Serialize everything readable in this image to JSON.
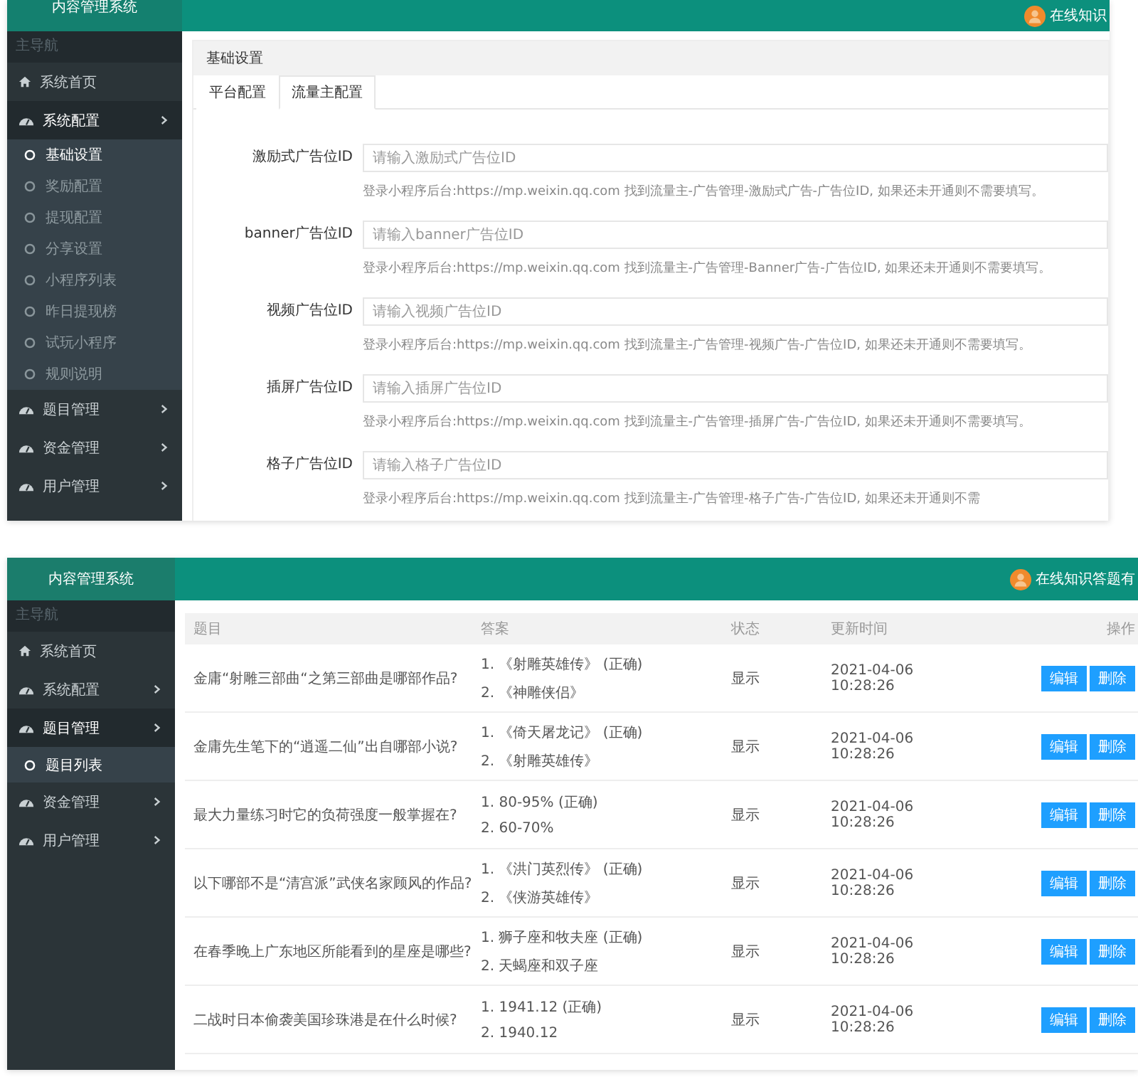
{
  "screens": [
    {
      "kind": "settings",
      "header": {
        "title": "内容管理系统",
        "user": "在线知识"
      },
      "sidebar": {
        "heading": "主导航",
        "items": [
          {
            "label": "系统首页",
            "kind": "link",
            "expanded": false
          },
          {
            "label": "系统配置",
            "kind": "menu",
            "expanded": true,
            "children": [
              {
                "label": "基础设置",
                "selected": true
              },
              {
                "label": "奖励配置",
                "selected": false
              },
              {
                "label": "提现配置",
                "selected": false
              },
              {
                "label": "分享设置",
                "selected": false
              },
              {
                "label": "小程序列表",
                "selected": false
              },
              {
                "label": "昨日提现榜",
                "selected": false
              },
              {
                "label": "试玩小程序",
                "selected": false
              },
              {
                "label": "规则说明",
                "selected": false
              }
            ]
          },
          {
            "label": "题目管理",
            "kind": "menu",
            "expanded": false
          },
          {
            "label": "资金管理",
            "kind": "menu",
            "expanded": false
          },
          {
            "label": "用户管理",
            "kind": "menu",
            "expanded": false
          }
        ]
      },
      "card": {
        "title": "基础设置",
        "tabs": [
          {
            "label": "平台配置",
            "selected": false
          },
          {
            "label": "流量主配置",
            "selected": true
          }
        ],
        "fields": [
          {
            "label": "激励式广告位ID",
            "placeholder": "请输入激励式广告位ID",
            "hint": "登录小程序后台:https://mp.weixin.qq.com 找到流量主-广告管理-激励式广告-广告位ID, 如果还未开通则不需要填写。"
          },
          {
            "label": "banner广告位ID",
            "placeholder": "请输入banner广告位ID",
            "hint": "登录小程序后台:https://mp.weixin.qq.com 找到流量主-广告管理-Banner广告-广告位ID, 如果还未开通则不需要填写。"
          },
          {
            "label": "视频广告位ID",
            "placeholder": "请输入视频广告位ID",
            "hint": "登录小程序后台:https://mp.weixin.qq.com 找到流量主-广告管理-视频广告-广告位ID, 如果还未开通则不需要填写。"
          },
          {
            "label": "插屏广告位ID",
            "placeholder": "请输入插屏广告位ID",
            "hint": "登录小程序后台:https://mp.weixin.qq.com 找到流量主-广告管理-插屏广告-广告位ID, 如果还未开通则不需要填写。"
          },
          {
            "label": "格子广告位ID",
            "placeholder": "请输入格子广告位ID",
            "hint": "登录小程序后台:https://mp.weixin.qq.com 找到流量主-广告管理-格子广告-广告位ID, 如果还未开通则不需"
          }
        ]
      }
    },
    {
      "kind": "table",
      "header": {
        "title": "内容管理系统",
        "user": "在线知识答题有"
      },
      "sidebar": {
        "heading": "主导航",
        "items": [
          {
            "label": "系统首页",
            "kind": "link",
            "expanded": false
          },
          {
            "label": "系统配置",
            "kind": "menu",
            "expanded": false
          },
          {
            "label": "题目管理",
            "kind": "menu",
            "expanded": true,
            "children": [
              {
                "label": "题目列表",
                "selected": true
              }
            ]
          },
          {
            "label": "资金管理",
            "kind": "menu",
            "expanded": false
          },
          {
            "label": "用户管理",
            "kind": "menu",
            "expanded": false
          }
        ]
      },
      "table": {
        "columns": [
          "题目",
          "答案",
          "状态",
          "更新时间",
          "操作"
        ],
        "rows": [
          {
            "question": "金庸“射雕三部曲“之第三部曲是哪部作品?",
            "answers": [
              "1. 《射雕英雄传》 (正确)",
              "2. 《神雕侠侣》"
            ],
            "status": "显示",
            "updated": "2021-04-06 10:28:26",
            "actions": [
              "编辑",
              "删除"
            ]
          },
          {
            "question": "金庸先生笔下的“逍遥二仙”出自哪部小说?",
            "answers": [
              "1. 《倚天屠龙记》 (正确)",
              "2. 《射雕英雄传》"
            ],
            "status": "显示",
            "updated": "2021-04-06 10:28:26",
            "actions": [
              "编辑",
              "删除"
            ]
          },
          {
            "question": "最大力量练习时它的负荷强度一般掌握在?",
            "answers": [
              "1. 80-95% (正确)",
              "2. 60-70%"
            ],
            "status": "显示",
            "updated": "2021-04-06 10:28:26",
            "actions": [
              "编辑",
              "删除"
            ]
          },
          {
            "question": "以下哪部不是“清宫派”武侠名家顾风的作品?",
            "answers": [
              "1. 《洪门英烈传》 (正确)",
              "2. 《侠游英雄传》"
            ],
            "status": "显示",
            "updated": "2021-04-06 10:28:26",
            "actions": [
              "编辑",
              "删除"
            ]
          },
          {
            "question": "在春季晚上广东地区所能看到的星座是哪些?",
            "answers": [
              "1. 狮子座和牧夫座 (正确)",
              "2. 天蝎座和双子座"
            ],
            "status": "显示",
            "updated": "2021-04-06 10:28:26",
            "actions": [
              "编辑",
              "删除"
            ]
          },
          {
            "question": "二战时日本偷袭美国珍珠港是在什么时候?",
            "answers": [
              "1. 1941.12 (正确)",
              "2. 1940.12"
            ],
            "status": "显示",
            "updated": "2021-04-06 10:28:26",
            "actions": [
              "编辑",
              "删除"
            ]
          }
        ]
      }
    }
  ]
}
